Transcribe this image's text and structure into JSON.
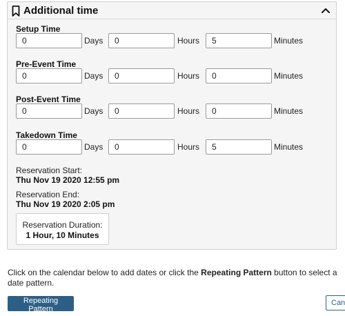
{
  "panel": {
    "title": "Additional time",
    "icons": {
      "header": "bookmark-icon",
      "collapse": "chevron-up-icon"
    }
  },
  "units": {
    "days": "Days",
    "hours": "Hours",
    "minutes": "Minutes"
  },
  "sections": {
    "setup": {
      "label": "Setup Time",
      "days": "0",
      "hours": "0",
      "minutes": "5"
    },
    "pre_event": {
      "label": "Pre-Event Time",
      "days": "0",
      "hours": "0",
      "minutes": "0"
    },
    "post_event": {
      "label": "Post-Event Time",
      "days": "0",
      "hours": "0",
      "minutes": "0"
    },
    "takedown": {
      "label": "Takedown Time",
      "days": "0",
      "hours": "0",
      "minutes": "5"
    }
  },
  "reservation": {
    "start_label": "Reservation Start:",
    "start_value": "Thu Nov 19 2020 12:55 pm",
    "end_label": "Reservation End:",
    "end_value": "Thu Nov 19 2020 2:05 pm",
    "duration_label": "Reservation Duration:",
    "duration_value": "1 Hour, 10 Minutes"
  },
  "hint": {
    "before": "Click on the calendar below to add dates or click the ",
    "bold": "Repeating Pattern",
    "after": " button to select a date pattern."
  },
  "buttons": {
    "repeating": "Repeating Pattern",
    "cancel": "Canc"
  },
  "colors": {
    "primary": "#2d5f86",
    "panel_bg": "#f5f5f5",
    "border": "#cfcfcf"
  }
}
